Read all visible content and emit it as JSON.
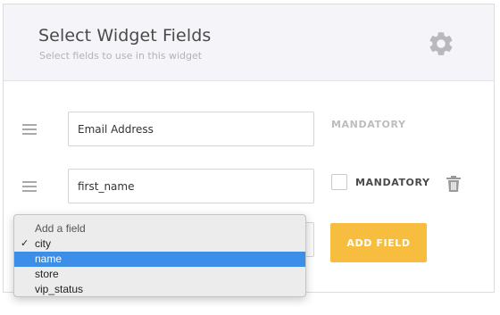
{
  "header": {
    "title": "Select Widget Fields",
    "subtitle": "Select fields to use in this widget",
    "settings_icon": "gear-icon"
  },
  "fields": [
    {
      "value": "Email Address",
      "mandatory_label": "MANDATORY",
      "mandatory_checked": true,
      "removable": false
    },
    {
      "value": "first_name",
      "mandatory_label": "MANDATORY",
      "mandatory_checked": false,
      "removable": true
    }
  ],
  "add_field": {
    "button_label": "ADD FIELD",
    "dropdown": {
      "prompt": "Add a field",
      "options": [
        "city",
        "name",
        "store",
        "vip_status"
      ],
      "checked_option": "city",
      "highlighted_option": "name"
    }
  },
  "colors": {
    "accent": "#f7bd3f",
    "highlight": "#3d8ee6",
    "header_bg": "#f5f5f9"
  }
}
